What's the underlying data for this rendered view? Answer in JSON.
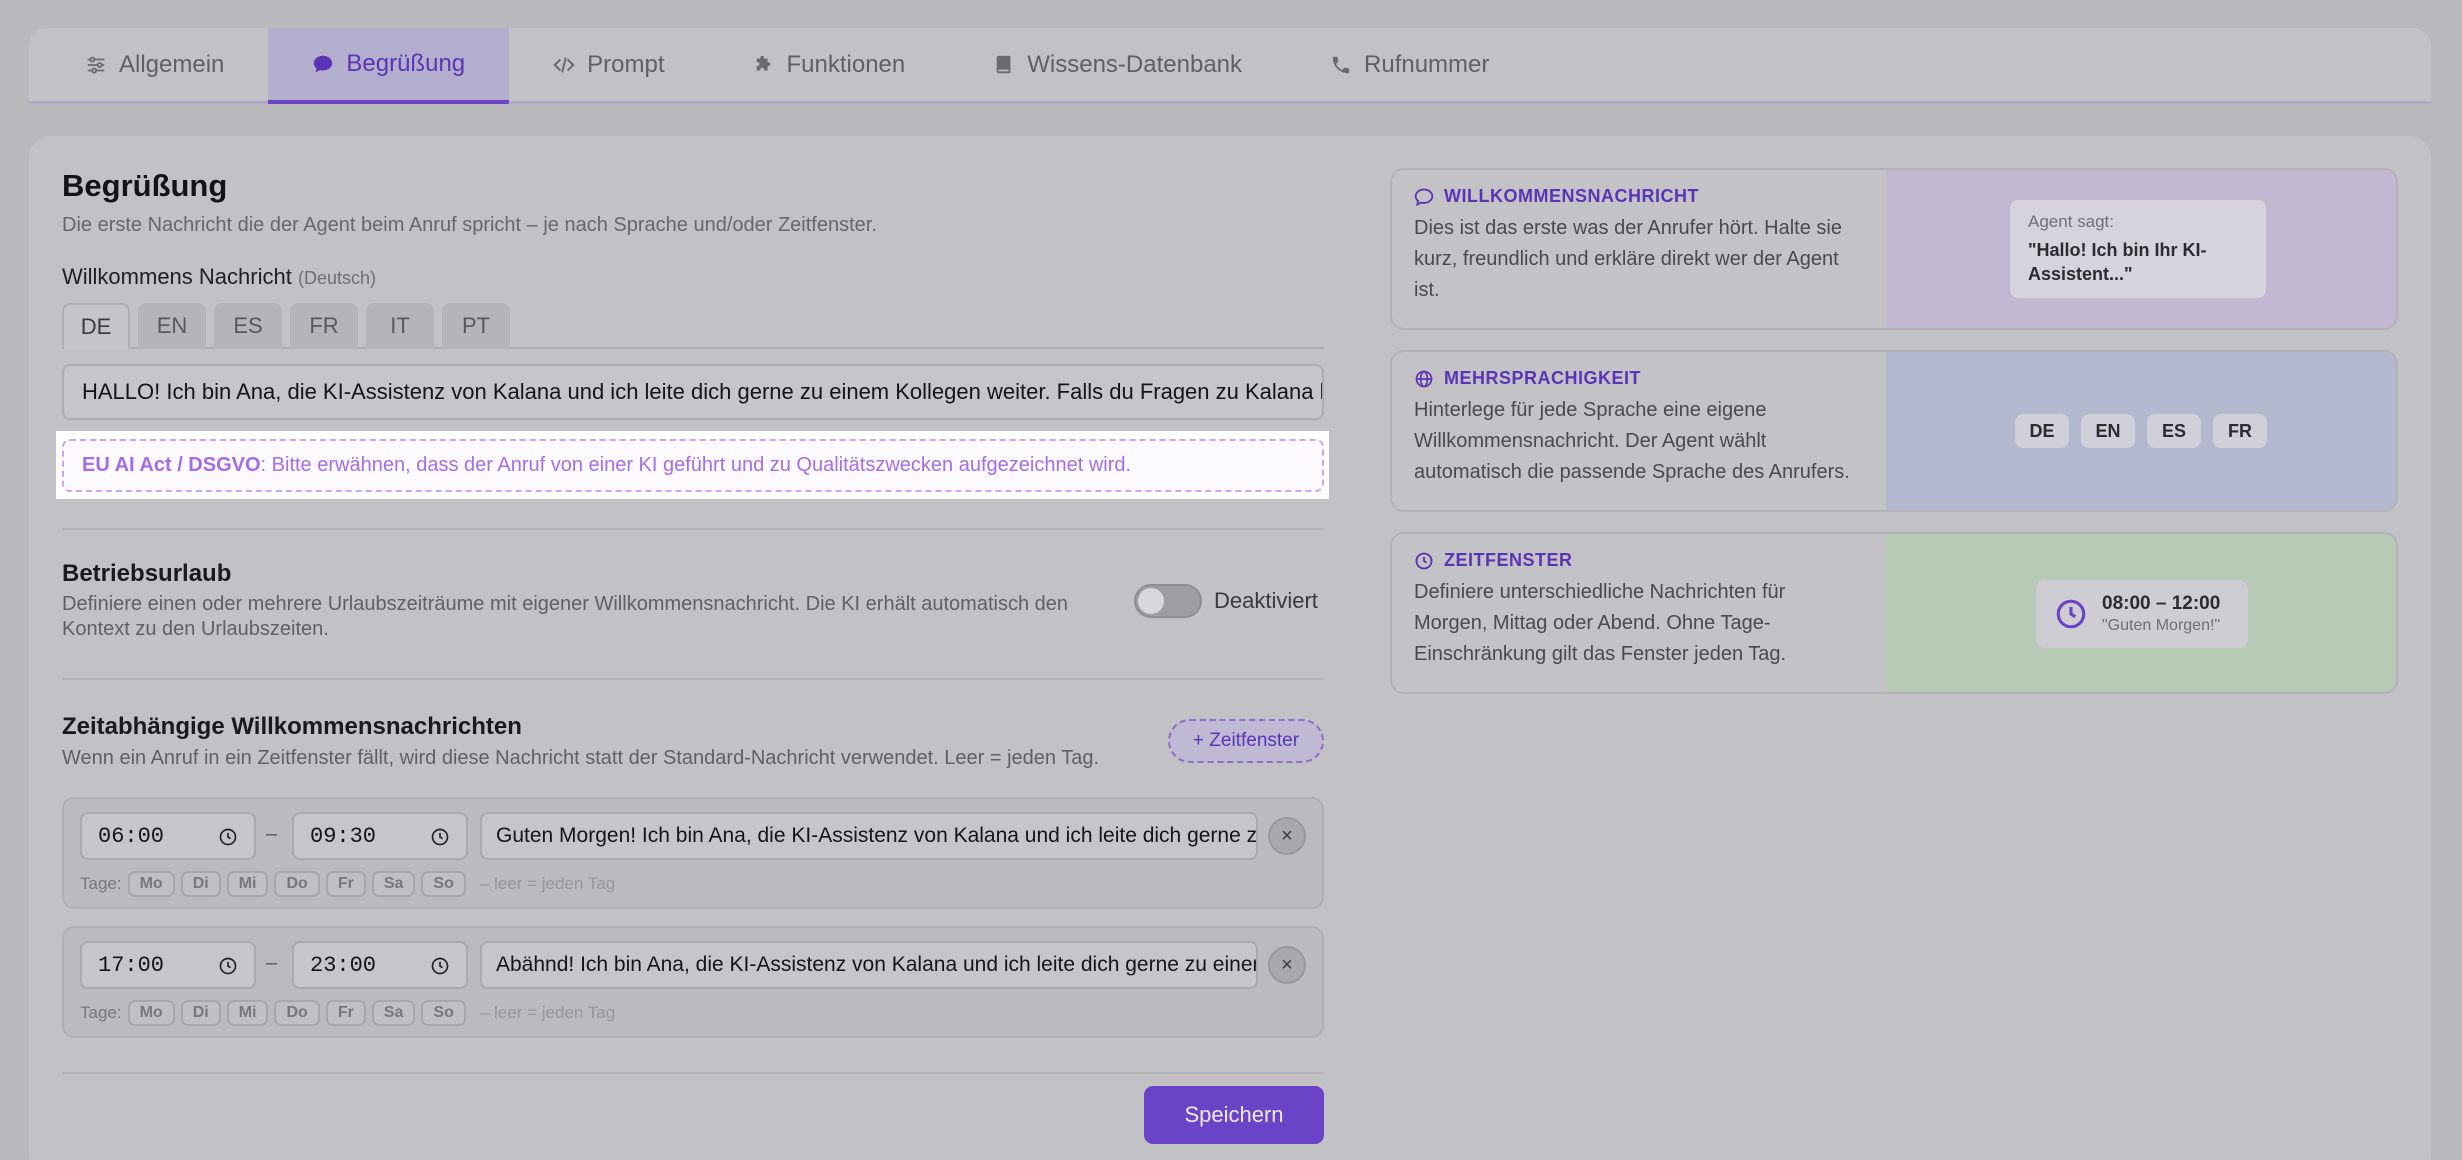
{
  "tabs": [
    {
      "label": "Allgemein",
      "icon": "sliders-icon"
    },
    {
      "label": "Begrüßung",
      "icon": "chat-bubble-icon",
      "active": true
    },
    {
      "label": "Prompt",
      "icon": "code-icon"
    },
    {
      "label": "Funktionen",
      "icon": "puzzle-icon"
    },
    {
      "label": "Wissens-Datenbank",
      "icon": "book-icon"
    },
    {
      "label": "Rufnummer",
      "icon": "phone-icon"
    }
  ],
  "greeting": {
    "title": "Begrüßung",
    "subtitle": "Die erste Nachricht die der Agent beim Anruf spricht – je nach Sprache und/oder Zeitfenster.",
    "field_label": "Willkommens Nachricht",
    "field_hint": "(Deutsch)",
    "languages": [
      "DE",
      "EN",
      "ES",
      "FR",
      "IT",
      "PT"
    ],
    "active_language": "DE",
    "message": "HALLO! Ich bin Ana, die KI-Assistenz von Kalana und ich leite dich gerne zu einem Kollegen weiter. Falls du Fragen zu Kalana hast, stell sie gerne.",
    "notice_label": "EU AI Act / DSGVO",
    "notice_text": ": Bitte erwähnen, dass der Anruf von einer KI geführt und zu Qualitätszwecken aufgezeichnet wird."
  },
  "vacation": {
    "title": "Betriebsurlaub",
    "subtitle": "Definiere einen oder mehrere Urlaubszeiträume mit eigener Willkommensnachricht. Die KI erhält automatisch den Kontext zu den Urlaubszeiten.",
    "toggle_label": "Deaktiviert",
    "enabled": false
  },
  "time_messages": {
    "title": "Zeitabhängige Willkommensnachrichten",
    "subtitle": "Wenn ein Anruf in ein Zeitfenster fällt, wird diese Nachricht statt der Standard-Nachricht verwendet. Leer = jeden Tag.",
    "add_label": "+ Zeitfenster",
    "days_label": "Tage:",
    "days": [
      "Mo",
      "Di",
      "Mi",
      "Do",
      "Fr",
      "Sa",
      "So"
    ],
    "empty_hint": "– leer = jeden Tag",
    "slots": [
      {
        "from": "06:00",
        "to": "09:30",
        "message": "Guten Morgen! Ich bin Ana, die KI-Assistenz von Kalana und ich leite dich gerne zu einem Kollegen weiter."
      },
      {
        "from": "17:00",
        "to": "23:00",
        "message": "Abähnd! Ich bin Ana, die KI-Assistenz von Kalana und ich leite dich gerne zu einem Kollegen weiter."
      }
    ],
    "delete_label": "×"
  },
  "save_label": "Speichern",
  "info_cards": {
    "welcome": {
      "title": "WILLKOMMENSNACHRICHT",
      "body": "Dies ist das erste was der Anrufer hört. Halte sie kurz, freundlich und erkläre direkt wer der Agent ist.",
      "bubble_label": "Agent sagt:",
      "bubble_text": "\"Hallo! Ich bin Ihr KI-Assistent...\""
    },
    "multilang": {
      "title": "MEHRSPRACHIGKEIT",
      "body": "Hinterlege für jede Sprache eine eigene Willkommensnachricht. Der Agent wählt automatisch die passende Sprache des Anrufers.",
      "chips": [
        "DE",
        "EN",
        "ES",
        "FR"
      ]
    },
    "timewindow": {
      "title": "ZEITFENSTER",
      "body": "Definiere unterschiedliche Nachrichten für Morgen, Mittag oder Abend. Ohne Tage-Einschränkung gilt das Fenster jeden Tag.",
      "time": "08:00 – 12:00",
      "sample": "\"Guten Morgen!\""
    }
  },
  "colors": {
    "accent": "#6b43c6",
    "notice": "#a56ee8",
    "welcome_bg": "#c2b8d2",
    "multilang_bg": "#b3b8cf",
    "timewindow_bg": "#b6cab5"
  }
}
